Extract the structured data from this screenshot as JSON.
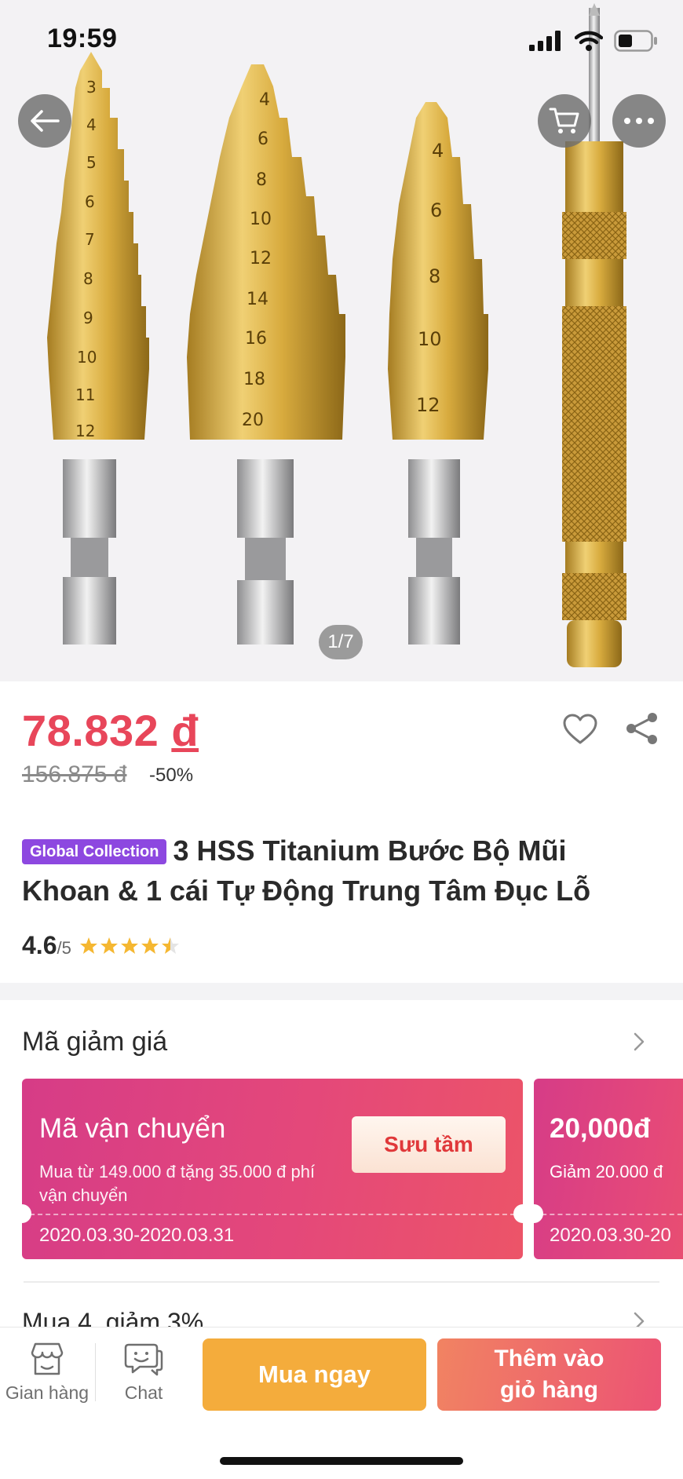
{
  "status_bar": {
    "time": "19:59"
  },
  "gallery": {
    "counter": "1/7"
  },
  "product": {
    "price": "78.832",
    "currency": "đ",
    "old_price": "156.875 đ",
    "discount": "-50%",
    "badge": "Global Collection",
    "title": "3 HSS Titanium Bước Bộ Mũi Khoan & 1 cái Tự Động Trung Tâm Đục Lỗ",
    "rating": "4.6",
    "rating_max": "/5",
    "stars": 4.5
  },
  "vouchers": {
    "section_title": "Mã giảm giá",
    "items": [
      {
        "title": "Mã vận chuyển",
        "desc": "Mua từ 149.000 đ tặng 35.000 đ phí vận chuyển",
        "date": "2020.03.30-2020.03.31",
        "button": "Sưu tầm"
      },
      {
        "title": "20,000đ",
        "desc": "Giảm 20.000 đ",
        "date": "2020.03.30-20"
      }
    ]
  },
  "promo": {
    "label": "Mua 4, giảm 3%"
  },
  "bottom_bar": {
    "store_label": "Gian hàng",
    "chat_label": "Chat",
    "buy_label": "Mua ngay",
    "add_cart_label": "Thêm vào giỏ hàng"
  },
  "colors": {
    "price": "#e8465a",
    "badge": "#8d48e0",
    "buy": "#f4ac3c",
    "add_cart": "#ec5374"
  }
}
